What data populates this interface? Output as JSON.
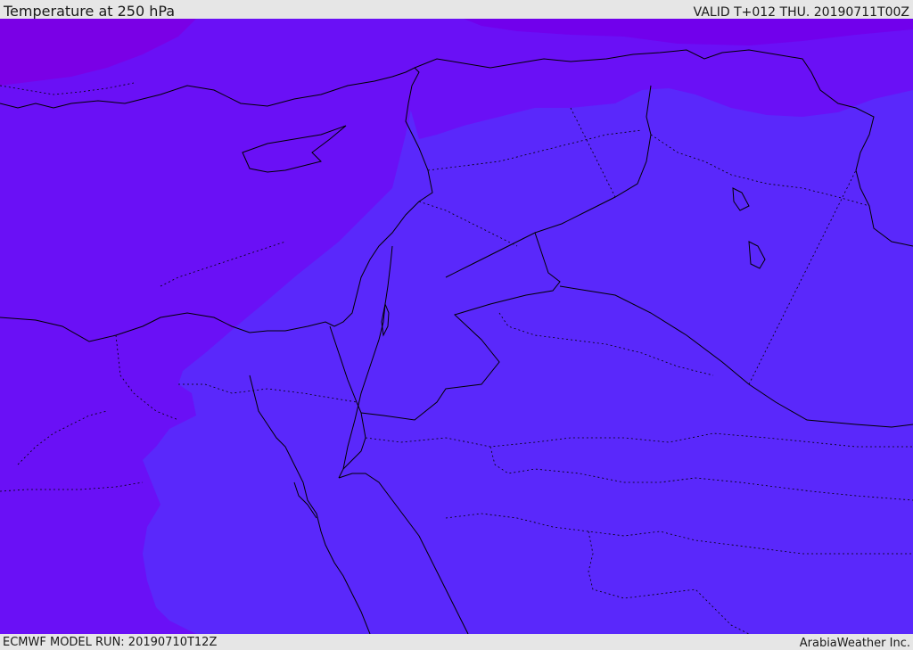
{
  "header": {
    "title": "Temperature at 250 hPa",
    "valid": "VALID T+012 THU. 20190711T00Z"
  },
  "footer": {
    "model_run": "ECMWF MODEL RUN: 20190710T12Z",
    "credit": "ArabiaWeather Inc."
  },
  "map": {
    "region": "Eastern Mediterranean and Middle East",
    "fill_colors": {
      "coldest": "#7a00e6",
      "cold": "#6e0cf6",
      "cool": "#5a27fa",
      "background": "#5a28fb"
    },
    "border_color": "#000000"
  }
}
